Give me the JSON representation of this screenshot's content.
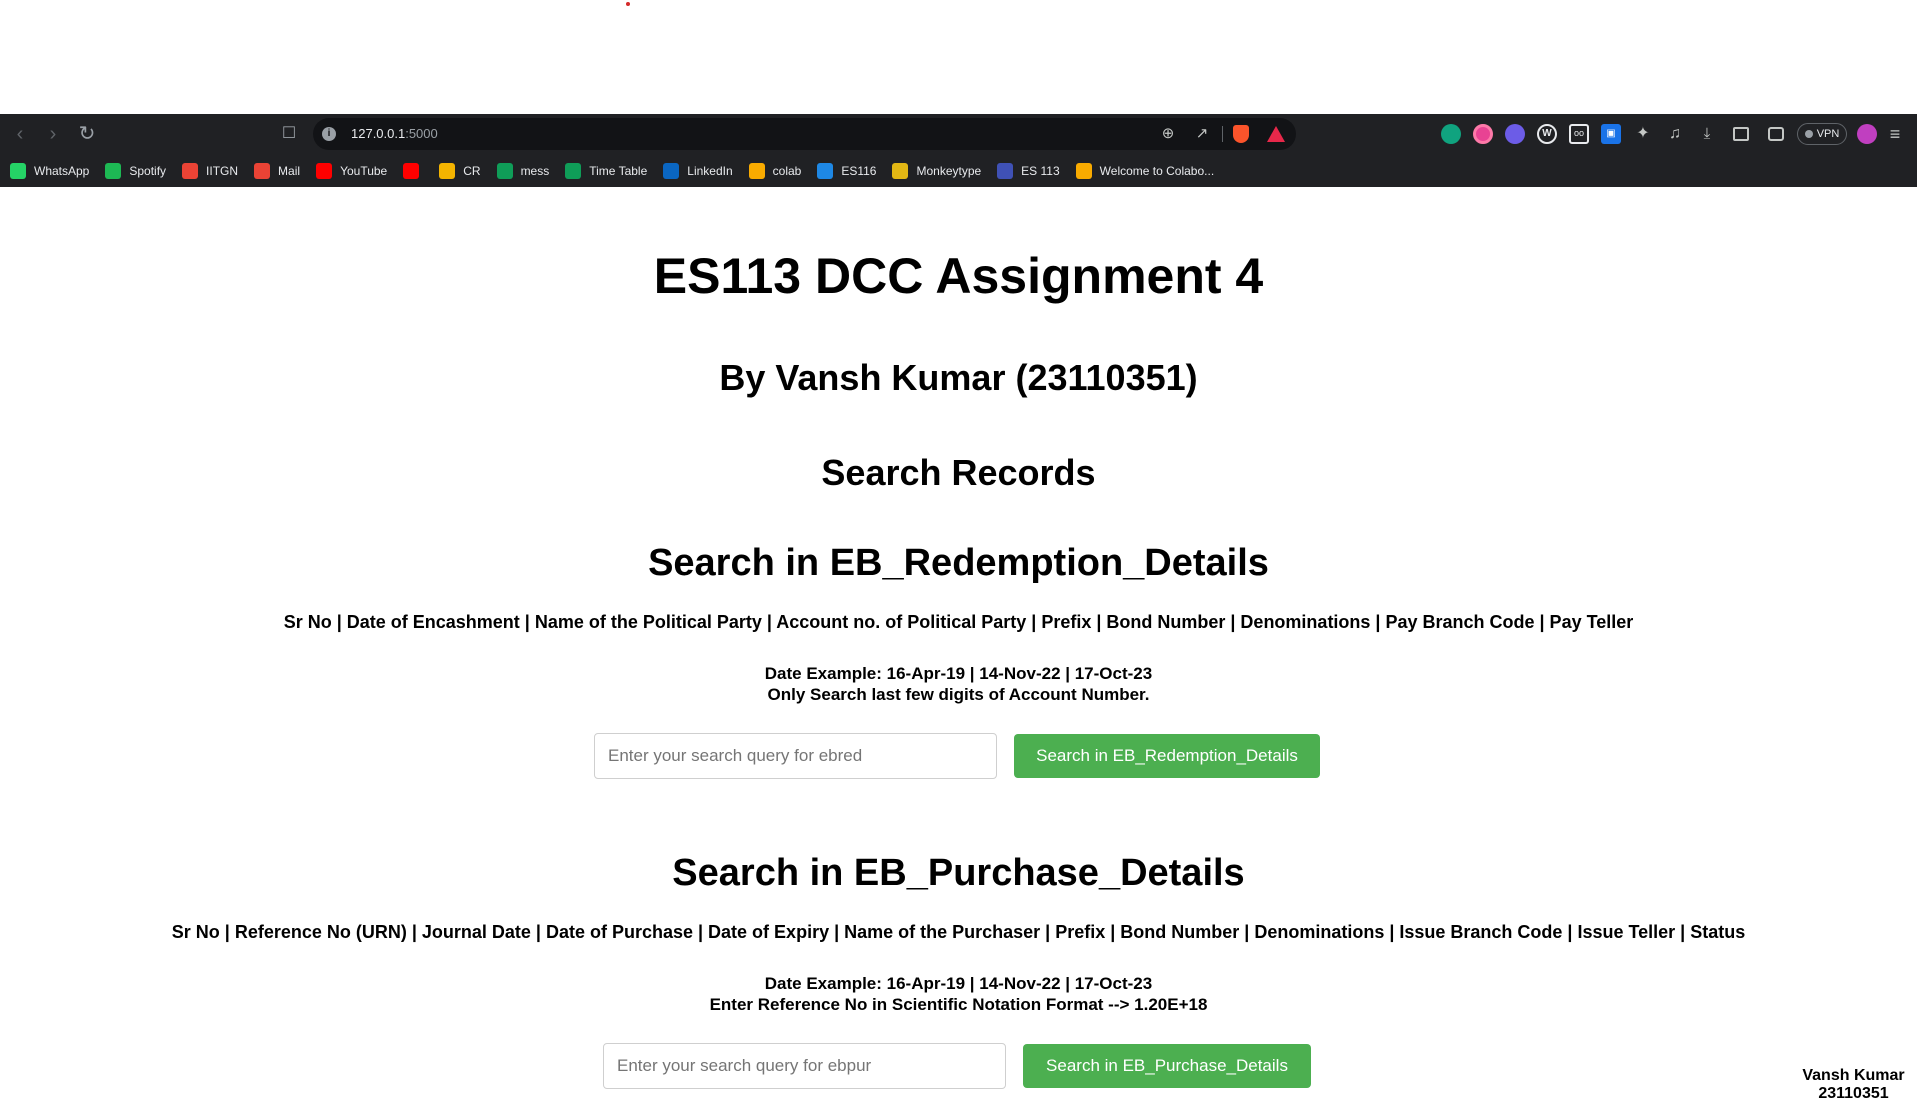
{
  "browser": {
    "url_host": "127.0.0.1",
    "url_port": ":5000",
    "vpn_label": "VPN",
    "bookmarks": [
      {
        "label": "WhatsApp",
        "color": "#25d366"
      },
      {
        "label": "Spotify",
        "color": "#1db954"
      },
      {
        "label": "IITGN",
        "color": "#ea4335"
      },
      {
        "label": "Mail",
        "color": "#ea4335"
      },
      {
        "label": "YouTube",
        "color": "#ff0000"
      },
      {
        "label": "",
        "color": "#ff0000"
      },
      {
        "label": "CR",
        "color": "#f4b400"
      },
      {
        "label": "mess",
        "color": "#0f9d58"
      },
      {
        "label": "Time Table",
        "color": "#0f9d58"
      },
      {
        "label": "LinkedIn",
        "color": "#0a66c2"
      },
      {
        "label": "colab",
        "color": "#f9ab00"
      },
      {
        "label": "ES116",
        "color": "#1e88e5"
      },
      {
        "label": "Monkeytype",
        "color": "#e2b714"
      },
      {
        "label": "ES 113",
        "color": "#3f51b5"
      },
      {
        "label": "Welcome to Colabo...",
        "color": "#f9ab00"
      }
    ]
  },
  "page": {
    "title": "ES113 DCC Assignment 4",
    "byline": "By Vansh Kumar (23110351)",
    "search_heading": "Search Records"
  },
  "ebred": {
    "heading": "Search in EB_Redemption_Details",
    "columns": "Sr No | Date of Encashment | Name of the Political Party | Account no. of Political Party | Prefix | Bond Number | Denominations | Pay Branch Code | Pay Teller",
    "date_example": "Date Example: 16-Apr-19 | 14-Nov-22 | 17-Oct-23",
    "note": "Only Search last few digits of Account Number.",
    "placeholder": "Enter your search query for ebred",
    "button": "Search in EB_Redemption_Details"
  },
  "ebpur": {
    "heading": "Search in EB_Purchase_Details",
    "columns": "Sr No | Reference No (URN) | Journal Date | Date of Purchase | Date of Expiry | Name of the Purchaser | Prefix | Bond Number | Denominations | Issue Branch Code | Issue Teller | Status",
    "date_example": "Date Example: 16-Apr-19 | 14-Nov-22 | 17-Oct-23",
    "note": "Enter Reference No in Scientific Notation Format --> 1.20E+18",
    "placeholder": "Enter your search query for ebpur",
    "button": "Search in EB_Purchase_Details"
  },
  "footer": {
    "name": "Vansh Kumar",
    "id": "23110351"
  },
  "colors": {
    "button_green": "#4caf50",
    "chrome_dark": "#202124"
  }
}
